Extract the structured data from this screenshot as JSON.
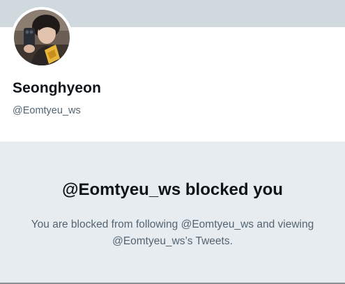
{
  "profile": {
    "display_name": "Seonghyeon",
    "handle": "@Eomtyeu_ws"
  },
  "blocked": {
    "title": "@Eomtyeu_ws blocked you",
    "message": "You are blocked from following @Eomtyeu_ws and viewing @Eomtyeu_ws’s Tweets."
  },
  "colors": {
    "banner": "#cfd9de",
    "blocked_background": "#e7ecf0",
    "primary_text": "#0f1419",
    "secondary_text": "#536471"
  }
}
